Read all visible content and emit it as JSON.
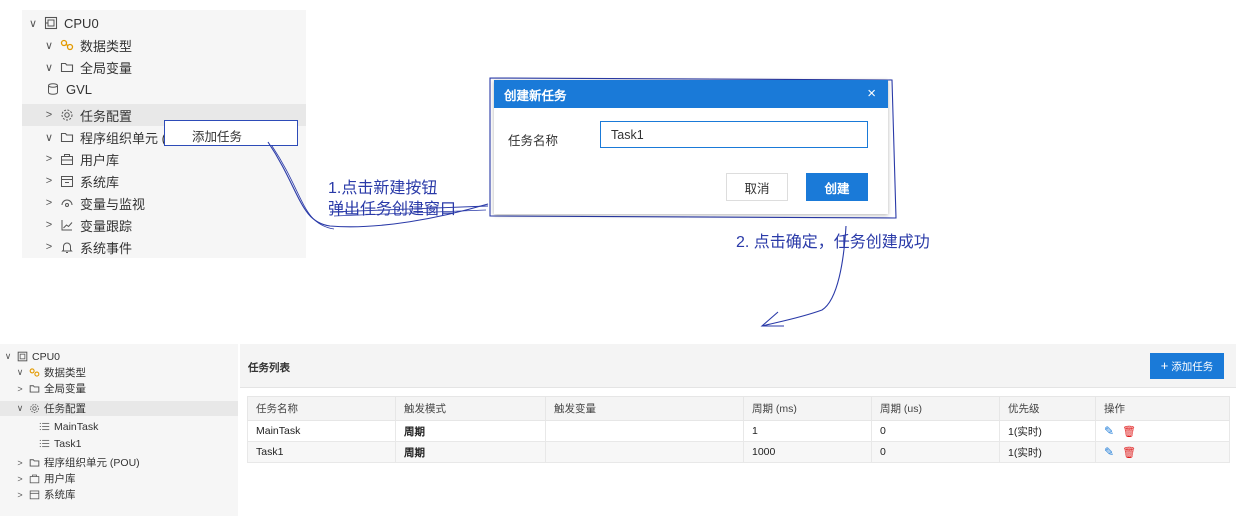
{
  "top_tree": {
    "items": [
      {
        "chevron": "∨",
        "icon": "cpu-icon",
        "label": "CPU0"
      },
      {
        "chevron": "∨",
        "icon": "datatype-icon",
        "label": "数据类型"
      },
      {
        "chevron": "∨",
        "icon": "folder-icon",
        "label": "全局变量"
      },
      {
        "chevron": "",
        "icon": "database-icon",
        "label": "GVL"
      },
      {
        "chevron": ">",
        "icon": "gear-icon",
        "label": "任务配置"
      },
      {
        "chevron": "∨",
        "icon": "folder-icon",
        "label": "程序组织单元 ("
      },
      {
        "chevron": ">",
        "icon": "library-icon",
        "label": "用户库"
      },
      {
        "chevron": ">",
        "icon": "system-library-icon",
        "label": "系统库"
      },
      {
        "chevron": ">",
        "icon": "watch-icon",
        "label": "变量与监视"
      },
      {
        "chevron": ">",
        "icon": "trace-icon",
        "label": "变量跟踪"
      },
      {
        "chevron": ">",
        "icon": "bell-icon",
        "label": "系统事件"
      }
    ]
  },
  "context_menu": {
    "add_task": "添加任务"
  },
  "annotations": {
    "step1_line1": "1.点击新建按钮",
    "step1_line2": "弹出任务创建窗口",
    "step2": "2. 点击确定，任务创建成功"
  },
  "dialog": {
    "title": "创建新任务",
    "close": "×",
    "name_label": "任务名称",
    "name_value": "Task1",
    "cancel": "取消",
    "create": "创建"
  },
  "bottom_tree": {
    "items": [
      {
        "chevron": "∨",
        "icon": "cpu-icon",
        "label": "CPU0"
      },
      {
        "chevron": "∨",
        "icon": "datatype-icon",
        "label": "数据类型"
      },
      {
        "chevron": ">",
        "icon": "folder-icon",
        "label": "全局变量"
      },
      {
        "chevron": "∨",
        "icon": "gear-icon",
        "label": "任务配置"
      },
      {
        "chevron": "",
        "icon": "task-list-icon",
        "label": "MainTask"
      },
      {
        "chevron": "",
        "icon": "task-list-icon",
        "label": "Task1"
      },
      {
        "chevron": ">",
        "icon": "folder-icon",
        "label": "程序组织单元 (POU)"
      },
      {
        "chevron": ">",
        "icon": "library-icon",
        "label": "用户库"
      },
      {
        "chevron": ">",
        "icon": "system-library-icon",
        "label": "系统库"
      }
    ]
  },
  "task_panel": {
    "title": "任务列表",
    "add_button": "添加任务",
    "add_button_icon": "+",
    "columns": [
      "任务名称",
      "触发模式",
      "触发变量",
      "周期 (ms)",
      "周期 (us)",
      "优先级",
      "操作"
    ],
    "rows": [
      [
        "MainTask",
        "周期",
        "",
        "1",
        "0",
        "1(实时)"
      ],
      [
        "Task1",
        "周期",
        "",
        "1000",
        "0",
        "1(实时)"
      ]
    ]
  },
  "colors": {
    "accent": "#1a7ad8",
    "annotation": "#2a3aa8",
    "delete": "#e01c1c"
  }
}
